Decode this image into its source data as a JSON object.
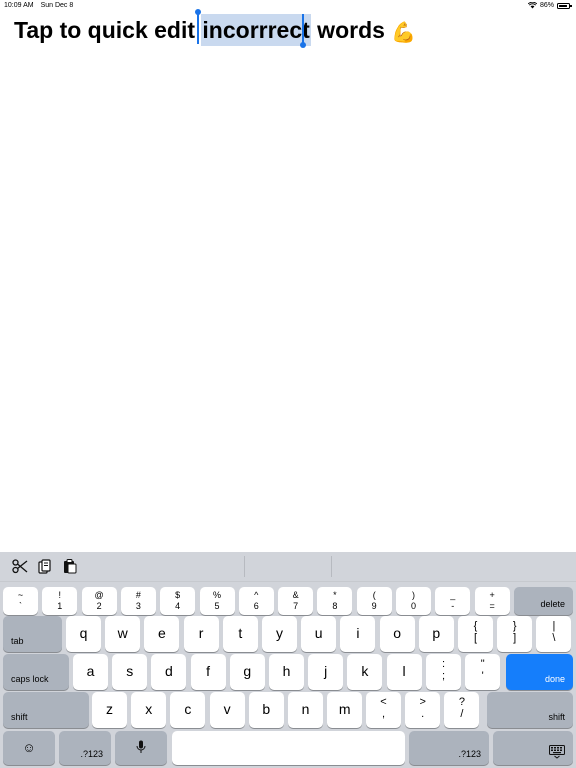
{
  "status": {
    "time": "10:09 AM",
    "date": "Sun Dec 8",
    "battery": "86%"
  },
  "editor": {
    "before": "Tap to quick edit ",
    "selected": "incorrrect",
    "after": " words",
    "emoji": "💪"
  },
  "shortcut_bar": {
    "icons": [
      "cut-icon",
      "copy-icon",
      "paste-icon"
    ]
  },
  "keyboard": {
    "number_row": [
      {
        "top": "~",
        "bot": "`"
      },
      {
        "top": "!",
        "bot": "1"
      },
      {
        "top": "@",
        "bot": "2"
      },
      {
        "top": "#",
        "bot": "3"
      },
      {
        "top": "$",
        "bot": "4"
      },
      {
        "top": "%",
        "bot": "5"
      },
      {
        "top": "^",
        "bot": "6"
      },
      {
        "top": "&",
        "bot": "7"
      },
      {
        "top": "*",
        "bot": "8"
      },
      {
        "top": "(",
        "bot": "9"
      },
      {
        "top": ")",
        "bot": "0"
      },
      {
        "top": "_",
        "bot": "-"
      },
      {
        "top": "+",
        "bot": "="
      }
    ],
    "delete": "delete",
    "tab": "tab",
    "row_q": [
      "q",
      "w",
      "e",
      "r",
      "t",
      "y",
      "u",
      "i",
      "o",
      "p"
    ],
    "row_q_sym": [
      {
        "top": "{",
        "bot": "["
      },
      {
        "top": "}",
        "bot": "]"
      },
      {
        "top": "|",
        "bot": "\\"
      }
    ],
    "caps": "caps lock",
    "row_a": [
      "a",
      "s",
      "d",
      "f",
      "g",
      "h",
      "j",
      "k",
      "l"
    ],
    "row_a_sym": [
      {
        "top": ":",
        "bot": ";"
      },
      {
        "top": "\"",
        "bot": "'"
      }
    ],
    "done": "done",
    "shift": "shift",
    "row_z": [
      "z",
      "x",
      "c",
      "v",
      "b",
      "n",
      "m"
    ],
    "row_z_sym": [
      {
        "top": "<",
        "bot": ","
      },
      {
        "top": ">",
        "bot": "."
      },
      {
        "top": "?",
        "bot": "/"
      }
    ],
    "numbers": ".?123",
    "emoji_key": "☺",
    "mic_key": "🎙",
    "hide_key": "⌨"
  }
}
